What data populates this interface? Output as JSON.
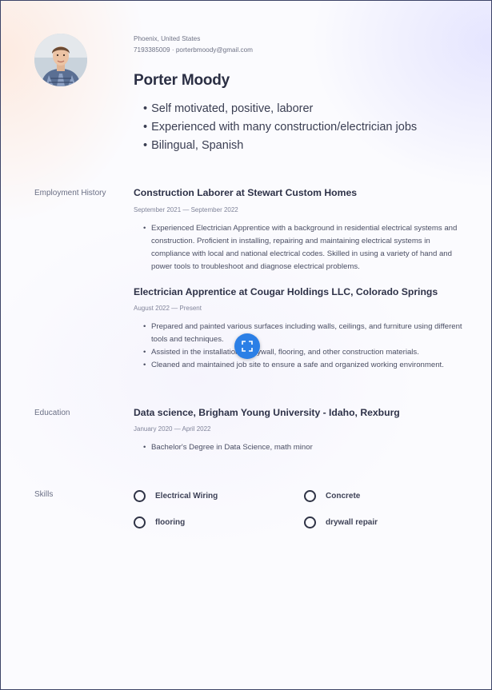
{
  "profile": {
    "location": "Phoenix, United States",
    "phone": "7193385009",
    "separator": "·",
    "email": "porterbmoody@gmail.com",
    "name": "Porter Moody",
    "summary": [
      "Self motivated, positive, laborer",
      "Experienced with many construction/electrician jobs",
      "Bilingual, Spanish"
    ]
  },
  "employment": {
    "label": "Employment History",
    "jobs": [
      {
        "title": "Construction Laborer at Stewart Custom Homes",
        "dates": "September 2021 — September 2022",
        "bullets": [
          "Experienced Electrician Apprentice with a background in residential electrical systems and construction. Proficient in installing, repairing and maintaining electrical systems in compliance with local and national electrical codes. Skilled in using a variety of hand and power tools to troubleshoot and diagnose electrical problems."
        ]
      },
      {
        "title": "Electrician Apprentice at Cougar Holdings LLC, Colorado Springs",
        "dates": "August 2022 — Present",
        "bullets": [
          "Prepared and painted various surfaces including walls, ceilings, and furniture using different tools and techniques.",
          "Assisted in the installation of drywall, flooring, and other construction materials.",
          "Cleaned and maintained job site to ensure a safe and organized working environment."
        ]
      }
    ]
  },
  "education": {
    "label": "Education",
    "title": "Data science, Brigham Young University - Idaho, Rexburg",
    "dates": "January 2020 — April 2022",
    "bullets": [
      "Bachelor's Degree in Data Science, math minor"
    ]
  },
  "skills": {
    "label": "Skills",
    "items": [
      "Electrical Wiring",
      "Concrete",
      "flooring",
      "drywall repair"
    ]
  },
  "expand_icon": "expand-icon",
  "colors": {
    "accent": "#2b7fe6",
    "text": "#2c3142",
    "border": "#3d4468"
  }
}
